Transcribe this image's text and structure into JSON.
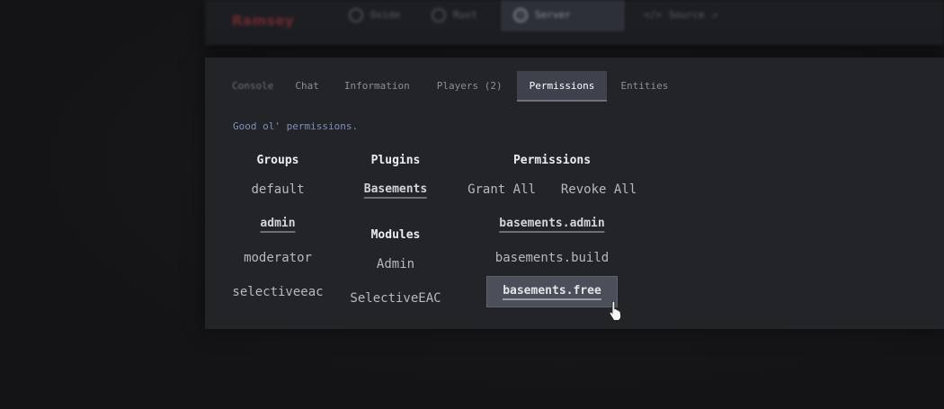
{
  "topnav": {
    "brand": "Ramsey",
    "items": [
      {
        "label": "Oxide",
        "icon": "circle-icon",
        "active": false
      },
      {
        "label": "Rust",
        "icon": "circle-icon",
        "active": false
      },
      {
        "label": "Server",
        "icon": "server-icon",
        "active": true
      },
      {
        "label": "Source",
        "icon": "code-icon",
        "active": false
      }
    ]
  },
  "tabs": [
    "Console",
    "Chat",
    "Information",
    "Players (2)",
    "Permissions",
    "Entities"
  ],
  "active_tab": "Permissions",
  "subtitle": "Good ol' permissions.",
  "groups": {
    "heading": "Groups",
    "items": [
      "default",
      "admin",
      "moderator",
      "selectiveeac"
    ],
    "selected": "admin"
  },
  "plugins": {
    "heading": "Plugins",
    "items": [
      "Basements"
    ],
    "selected": "Basements"
  },
  "modules": {
    "heading": "Modules",
    "items": [
      "Admin",
      "SelectiveEAC"
    ]
  },
  "permissions": {
    "heading": "Permissions",
    "grant_all": "Grant All",
    "revoke_all": "Revoke All",
    "items": [
      "basements.admin",
      "basements.build",
      "basements.free"
    ],
    "granted": [
      "basements.admin"
    ],
    "hovered": "basements.free"
  },
  "colors": {
    "background": "#141416",
    "panel": "#232427",
    "active_tab": "#3d424d",
    "subtitle": "#7f8fb8",
    "hover_button": "#4a4f5a"
  }
}
